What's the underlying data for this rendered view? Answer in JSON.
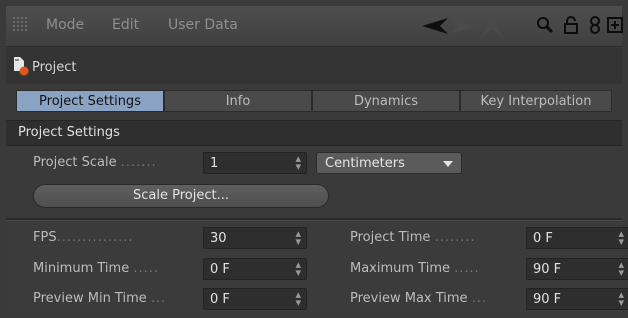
{
  "menubar": {
    "items": [
      "Mode",
      "Edit",
      "User Data"
    ]
  },
  "header": {
    "object_name": "Project"
  },
  "tabs": [
    {
      "label": "Project Settings",
      "active": true
    },
    {
      "label": "Info",
      "active": false
    },
    {
      "label": "Dynamics",
      "active": false
    },
    {
      "label": "Key Interpolation",
      "active": false
    }
  ],
  "section": {
    "title": "Project Settings"
  },
  "scale": {
    "label": "Project Scale",
    "dots": ".......",
    "value": "1",
    "unit": "Centimeters",
    "button": "Scale Project..."
  },
  "time": {
    "fps": {
      "label": "FPS",
      "dots": "...............",
      "value": "30"
    },
    "project_time": {
      "label": "Project Time",
      "dots": "........",
      "value": "0 F"
    },
    "min_time": {
      "label": "Minimum Time",
      "dots": ".....",
      "value": "0 F"
    },
    "max_time": {
      "label": "Maximum Time",
      "dots": ".....",
      "value": "90 F"
    },
    "prev_min": {
      "label": "Preview Min Time",
      "dots": "...",
      "value": "0 F"
    },
    "prev_max": {
      "label": "Preview Max Time",
      "dots": "...",
      "value": "90 F"
    }
  },
  "icons": {
    "back": "left-arrow-icon",
    "forward": "right-arrow-icon",
    "up": "up-arrow-icon",
    "search": "search-icon",
    "lock": "lock-icon",
    "link": "link-icon",
    "new_panel": "new-panel-icon",
    "project": "project-icon"
  },
  "colors": {
    "active_tab": "#8aa3c4",
    "background": "#3a3a3a"
  }
}
